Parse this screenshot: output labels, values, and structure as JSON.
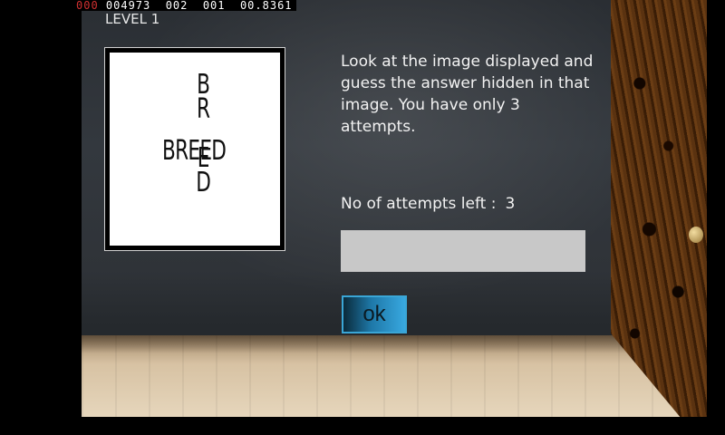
{
  "hud": {
    "counter_red": "000",
    "counter_rest": " 004973  002  001  00.8361"
  },
  "level_label": "LEVEL 1",
  "puzzle": {
    "vertical_letters": [
      "B",
      "R",
      "E",
      "E",
      "D"
    ],
    "horizontal_word": "BREED"
  },
  "instructions": "Look at the image displayed and guess the answer hidden in that image. You have only 3 attempts.",
  "attempts": {
    "label": "No of attempts left :",
    "value": "3"
  },
  "answer_input": {
    "value": "",
    "placeholder": ""
  },
  "ok_button": {
    "label": "ok"
  },
  "colors": {
    "wall": "#33383e",
    "floor": "#e0cdb0",
    "button_accent": "#38a8e0",
    "door": "#5a3210"
  }
}
